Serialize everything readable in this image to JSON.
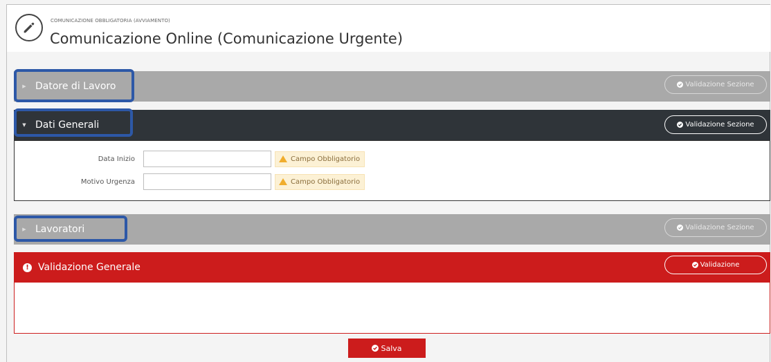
{
  "header": {
    "breadcrumb": "COMUNICAZIONE OBBLIGATORIA (AVVIAMENTO)",
    "title": "Comunicazione Online (Comunicazione Urgente)",
    "icon": "pencil-icon"
  },
  "sections": {
    "datore": {
      "title": "Datore di Lavoro",
      "validate_label": "Validazione Sezione",
      "expanded": false
    },
    "dati": {
      "title": "Dati Generali",
      "validate_label": "Validazione Sezione",
      "expanded": true
    },
    "lavoratori": {
      "title": "Lavoratori",
      "validate_label": "Validazione Sezione",
      "expanded": false
    },
    "generale": {
      "title": "Validazione Generale",
      "validate_label": "Validazione"
    }
  },
  "form": {
    "fields": [
      {
        "label": "Data Inizio",
        "value": "",
        "warning": "Campo Obbligatorio"
      },
      {
        "label": "Motivo Urgenza",
        "value": "",
        "warning": "Campo Obbligatorio"
      }
    ]
  },
  "actions": {
    "save_label": "Salva"
  },
  "colors": {
    "grey_bar": "#a9a9a9",
    "dark_bar": "#2f3439",
    "red": "#cc1c1c",
    "highlight": "#2d58a7",
    "warning_bg": "#fcf1d5"
  }
}
